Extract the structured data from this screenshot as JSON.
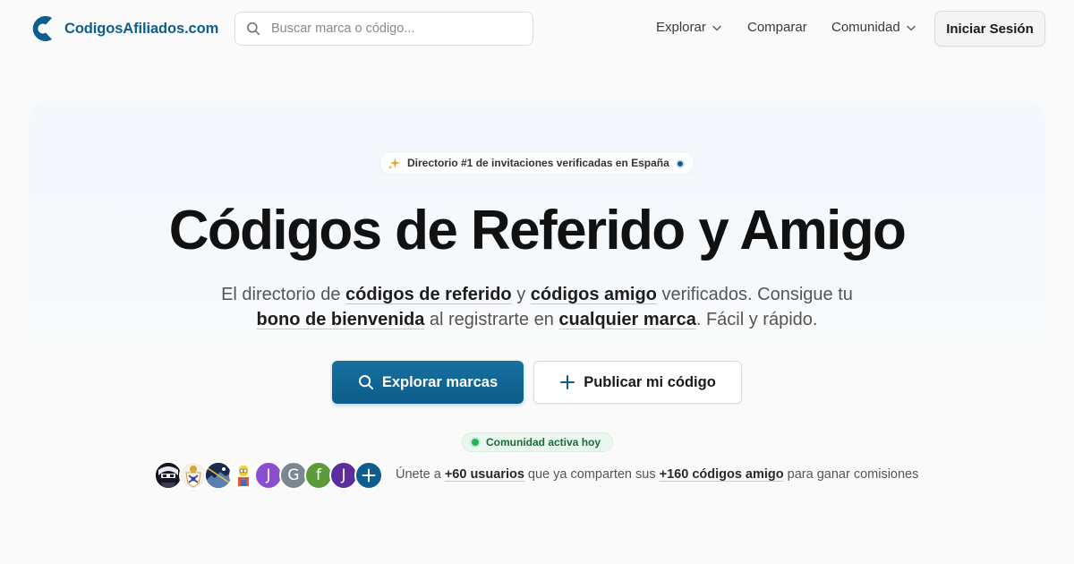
{
  "header": {
    "logo_text": "CodigosAfiliados.com",
    "search_placeholder": "Buscar marca o código...",
    "nav": [
      {
        "label": "Explorar",
        "has_dropdown": true
      },
      {
        "label": "Comparar",
        "has_dropdown": false
      },
      {
        "label": "Comunidad",
        "has_dropdown": true
      }
    ],
    "login_label": "Iniciar Sesión"
  },
  "hero": {
    "badge_text": "Directorio #1 de invitaciones verificadas en España",
    "title": "Códigos de Referido y Amigo",
    "subtitle": {
      "p1": "El directorio de ",
      "l1": "códigos de referido",
      "p2": " y ",
      "l2": "códigos amigo",
      "p3": " verificados. Consigue tu ",
      "l3": "bono de bienvenida",
      "p4": " al registrarte en ",
      "l4": "cualquier marca",
      "p5": ". Fácil y rápido."
    },
    "primary_button": "Explorar marcas",
    "secondary_button": "Publicar mi código",
    "active_pill": "Comunidad activa hoy"
  },
  "community": {
    "avatars": [
      {
        "type": "image",
        "icon": "anime-avatar-dark"
      },
      {
        "type": "image",
        "icon": "crest-avatar"
      },
      {
        "type": "image",
        "icon": "night-city-avatar"
      },
      {
        "type": "image",
        "icon": "cartoon-avatar"
      },
      {
        "type": "letter",
        "letter": "J",
        "color": "#8a4fd1"
      },
      {
        "type": "letter",
        "letter": "G",
        "color": "#7b8790"
      },
      {
        "type": "letter",
        "letter": "f",
        "color": "#5c9a3a"
      },
      {
        "type": "letter",
        "letter": "J",
        "color": "#5b2e9c"
      },
      {
        "type": "plus",
        "icon": "plus-icon",
        "color": "#0d5e8f"
      }
    ],
    "join": {
      "p1": "Únete a ",
      "users": "+60 usuarios",
      "p2": " que ya comparten sus ",
      "codes": "+160 códigos amigo",
      "p3": " para ganar comisiones"
    }
  },
  "colors": {
    "brand": "#0d5e8f",
    "active_green": "#22b455"
  }
}
